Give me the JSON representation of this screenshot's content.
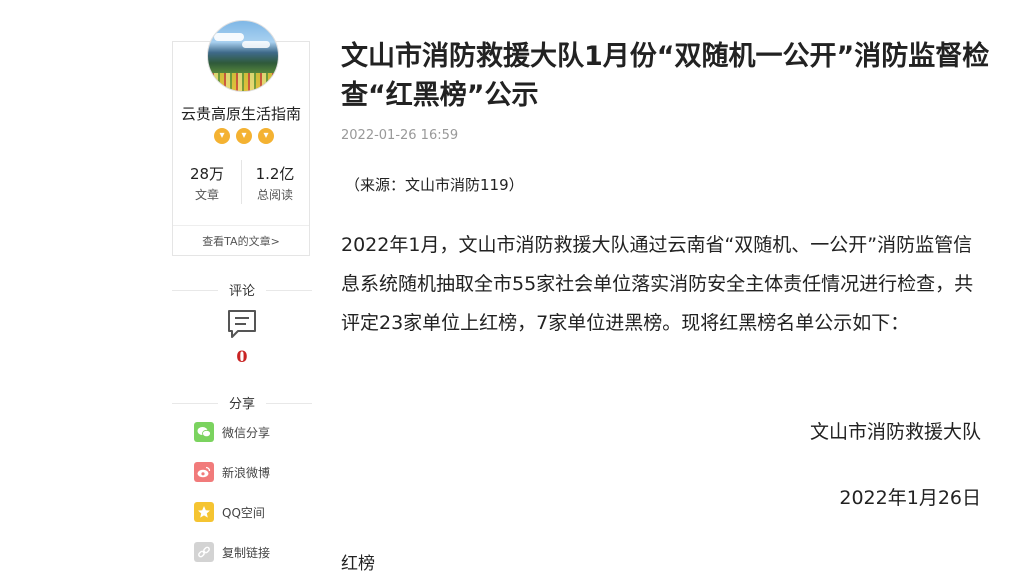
{
  "author": {
    "name": "云贵高原生活指南",
    "badge_icons": [
      "fox-icon",
      "fox-icon",
      "fox-icon"
    ],
    "stats": [
      {
        "value": "28万",
        "label": "文章"
      },
      {
        "value": "1.2亿",
        "label": "总阅读"
      }
    ],
    "more_link": "查看TA的文章>"
  },
  "comments": {
    "title": "评论",
    "count": "0"
  },
  "share": {
    "title": "分享",
    "items": [
      {
        "label": "微信分享",
        "icon": "wechat-icon",
        "color": "#7bd35f"
      },
      {
        "label": "新浪微博",
        "icon": "weibo-icon",
        "color": "#f17b7b"
      },
      {
        "label": "QQ空间",
        "icon": "qzone-icon",
        "color": "#f5c431"
      },
      {
        "label": "复制链接",
        "icon": "link-icon",
        "color": "#d3d3d3"
      }
    ]
  },
  "article": {
    "title": "文山市消防救援大队1月份“双随机一公开”消防监督检查“红黑榜”公示",
    "date": "2022-01-26 16:59",
    "source": "（来源：文山市消防119）",
    "body": "2022年1月，文山市消防救援大队通过云南省“双随机、一公开”消防监管信息系统随机抽取全市55家社会单位落实消防安全主体责任情况进行检查，共评定23家单位上红榜，7家单位进黑榜。现将红黑榜名单公示如下：",
    "signature_org": "文山市消防救援大队",
    "signature_date": "2022年1月26日",
    "subheading": "红榜"
  }
}
